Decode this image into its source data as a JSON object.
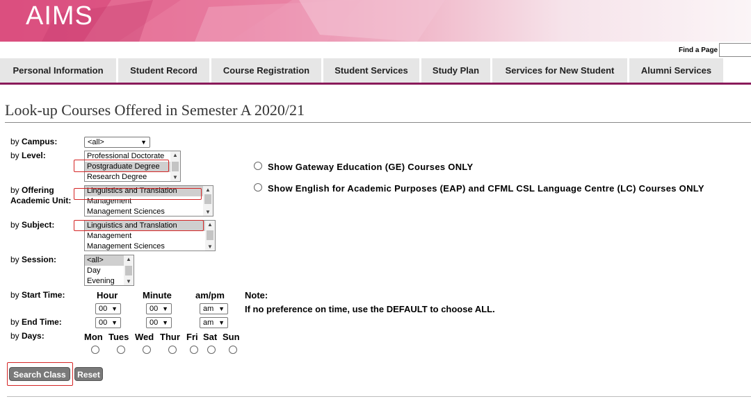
{
  "app": {
    "logo": "AIMS"
  },
  "header": {
    "find_label": "Find a Page",
    "find_value": ""
  },
  "nav": [
    {
      "label": "Personal Information"
    },
    {
      "label": "Student Record"
    },
    {
      "label": "Course Registration"
    },
    {
      "label": "Student Services"
    },
    {
      "label": "Study Plan"
    },
    {
      "label": "Services for New Student"
    },
    {
      "label": "Alumni Services"
    }
  ],
  "page_title": "Look-up Courses Offered in Semester A 2020/21",
  "form": {
    "campus": {
      "by": "by ",
      "label": "Campus:",
      "value": "<all>"
    },
    "level": {
      "by": "by ",
      "label": "Level:",
      "options": [
        "Professional Doctorate",
        "Postgraduate Degree",
        "Research Degree"
      ]
    },
    "offering": {
      "by": "by ",
      "label1": "Offering",
      "label2": "Academic Unit:",
      "options": [
        "Linguistics and Translation",
        "Management",
        "Management Sciences"
      ]
    },
    "subject": {
      "by": "by ",
      "label": "Subject:",
      "options": [
        "Linguistics and Translation",
        "Management",
        "Management Sciences"
      ]
    },
    "session": {
      "by": "by ",
      "label": "Session:",
      "options": [
        "<all>",
        "Day",
        "Evening"
      ]
    },
    "start_time": {
      "by": "by ",
      "label": "Start Time:",
      "hour": "00",
      "minute": "00",
      "ampm": "am"
    },
    "end_time": {
      "by": "by ",
      "label": "End Time:",
      "hour": "00",
      "minute": "00",
      "ampm": "am"
    },
    "time_headers": {
      "hour": "Hour",
      "minute": "Minute",
      "ampm": "am/pm"
    },
    "days": {
      "by": "by ",
      "label": "Days:",
      "list": [
        "Mon",
        "Tues",
        "Wed",
        "Thur",
        "Fri",
        "Sat",
        "Sun"
      ]
    },
    "note_title": "Note:",
    "note_text_1": "If no preference on time, use the ",
    "note_default": "DEFAULT",
    "note_text_2": " to choose ",
    "note_all": "ALL",
    "note_end": ".",
    "ge_option": "Show Gateway Education (GE) Courses ONLY",
    "eap_option": "Show English for Academic Purposes (EAP) and CFML CSL Language Centre (LC) Courses ONLY",
    "search_button": "Search Class",
    "reset_button": "Reset"
  },
  "colors": {
    "nav_rule": "#8a1a5a",
    "highlight": "#d42424",
    "nav_bg": "#e6e6e6"
  }
}
